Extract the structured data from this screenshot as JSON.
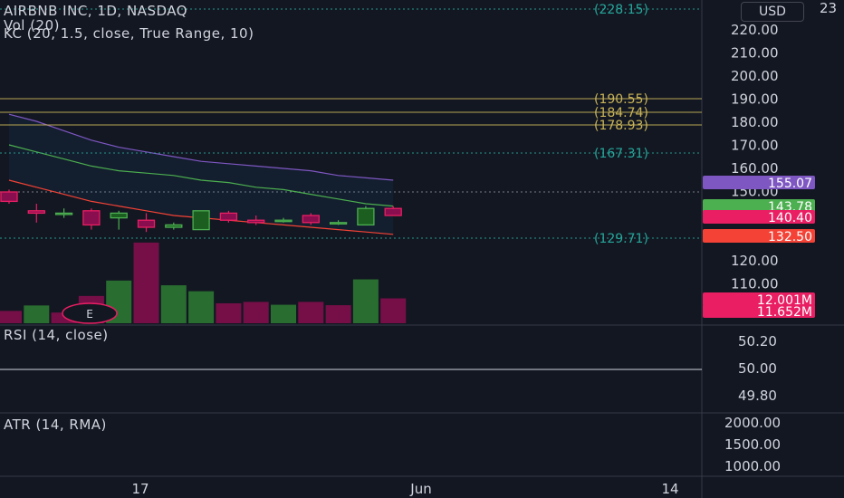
{
  "legend": {
    "main": "AIRBNB INC, 1D, NASDAQ",
    "vol": "Vol (20)",
    "kc": "KC (20, 1.5, close, True Range, 10)",
    "rsi": "RSI (14, close)",
    "atr": "ATR (14, RMA)"
  },
  "currency_button": "USD",
  "price_ticks": [
    "220.00",
    "210.00",
    "200.00",
    "190.00",
    "180.00",
    "170.00",
    "160.00",
    "150.00",
    "140.00",
    "130.00",
    "120.00",
    "110.00"
  ],
  "top_cut_label": "23",
  "horizontal_levels": [
    {
      "label": "(228.15)",
      "color": "#26a69a"
    },
    {
      "label": "(190.55)",
      "color": "#c9b458"
    },
    {
      "label": "(184.74)",
      "color": "#c9b458"
    },
    {
      "label": "(178.93)",
      "color": "#c9b458"
    },
    {
      "label": "(167.31)",
      "color": "#26a69a"
    },
    {
      "label": "(129.71)",
      "color": "#26a69a"
    }
  ],
  "price_badges": [
    {
      "label": "155.07",
      "color": "#7e57c2"
    },
    {
      "label": "143.78",
      "color": "#4caf50"
    },
    {
      "label": "140.40",
      "color": "#e91e63"
    },
    {
      "label": "132.50",
      "color": "#f44336"
    },
    {
      "label": "12.001M",
      "color": "#e91e63"
    },
    {
      "label": "11.652M",
      "color": "#e91e63"
    }
  ],
  "rsi_ticks": [
    "50.20",
    "50.00",
    "49.80"
  ],
  "atr_ticks": [
    "2000.00",
    "1500.00",
    "1000.00"
  ],
  "time_ticks": [
    "17",
    "Jun",
    "14"
  ],
  "event_marker": "E",
  "colors": {
    "background": "#131722",
    "up": "#4caf50",
    "down": "#e91e63",
    "grid_text": "#d1d4dc"
  },
  "chart_data": {
    "type": "candlestick",
    "candles": [
      {
        "open": 150,
        "high": 151,
        "low": 145,
        "close": 146
      },
      {
        "open": 142,
        "high": 145,
        "low": 137,
        "close": 141
      },
      {
        "open": 141,
        "high": 143,
        "low": 139,
        "close": 141
      },
      {
        "open": 142,
        "high": 143,
        "low": 134,
        "close": 136
      },
      {
        "open": 139,
        "high": 142,
        "low": 134,
        "close": 141
      },
      {
        "open": 138,
        "high": 141,
        "low": 133,
        "close": 135
      },
      {
        "open": 135,
        "high": 137,
        "low": 134,
        "close": 136
      },
      {
        "open": 134,
        "high": 142,
        "low": 134,
        "close": 142
      },
      {
        "open": 141,
        "high": 142,
        "low": 137,
        "close": 138
      },
      {
        "open": 138,
        "high": 140,
        "low": 136,
        "close": 137
      },
      {
        "open": 138,
        "high": 139,
        "low": 137,
        "close": 138
      },
      {
        "open": 140,
        "high": 141,
        "low": 136,
        "close": 137
      },
      {
        "open": 137,
        "high": 138,
        "low": 136,
        "close": 137
      },
      {
        "open": 136,
        "high": 144,
        "low": 136,
        "close": 143
      },
      {
        "open": 143,
        "high": 144,
        "low": 140,
        "close": 140
      }
    ],
    "volume": [
      5.2,
      7.5,
      4.5,
      11.5,
      18,
      34,
      16,
      13.5,
      8.4,
      9,
      7.8,
      9,
      7.6,
      18.5,
      10.5
    ],
    "volume_up": [
      false,
      true,
      false,
      false,
      true,
      false,
      true,
      true,
      false,
      false,
      true,
      false,
      false,
      true,
      false
    ],
    "kc_upper": [
      183,
      180,
      176,
      172,
      169,
      167,
      165,
      163,
      162,
      161,
      160,
      159,
      157,
      156,
      155
    ],
    "kc_middle": [
      170,
      167,
      164,
      161,
      159,
      158,
      157,
      155,
      154,
      152,
      151,
      149,
      147,
      145,
      144
    ],
    "kc_lower": [
      155,
      152,
      149,
      146,
      144,
      142,
      140,
      139,
      138,
      137,
      136,
      135,
      134,
      133,
      132
    ]
  }
}
